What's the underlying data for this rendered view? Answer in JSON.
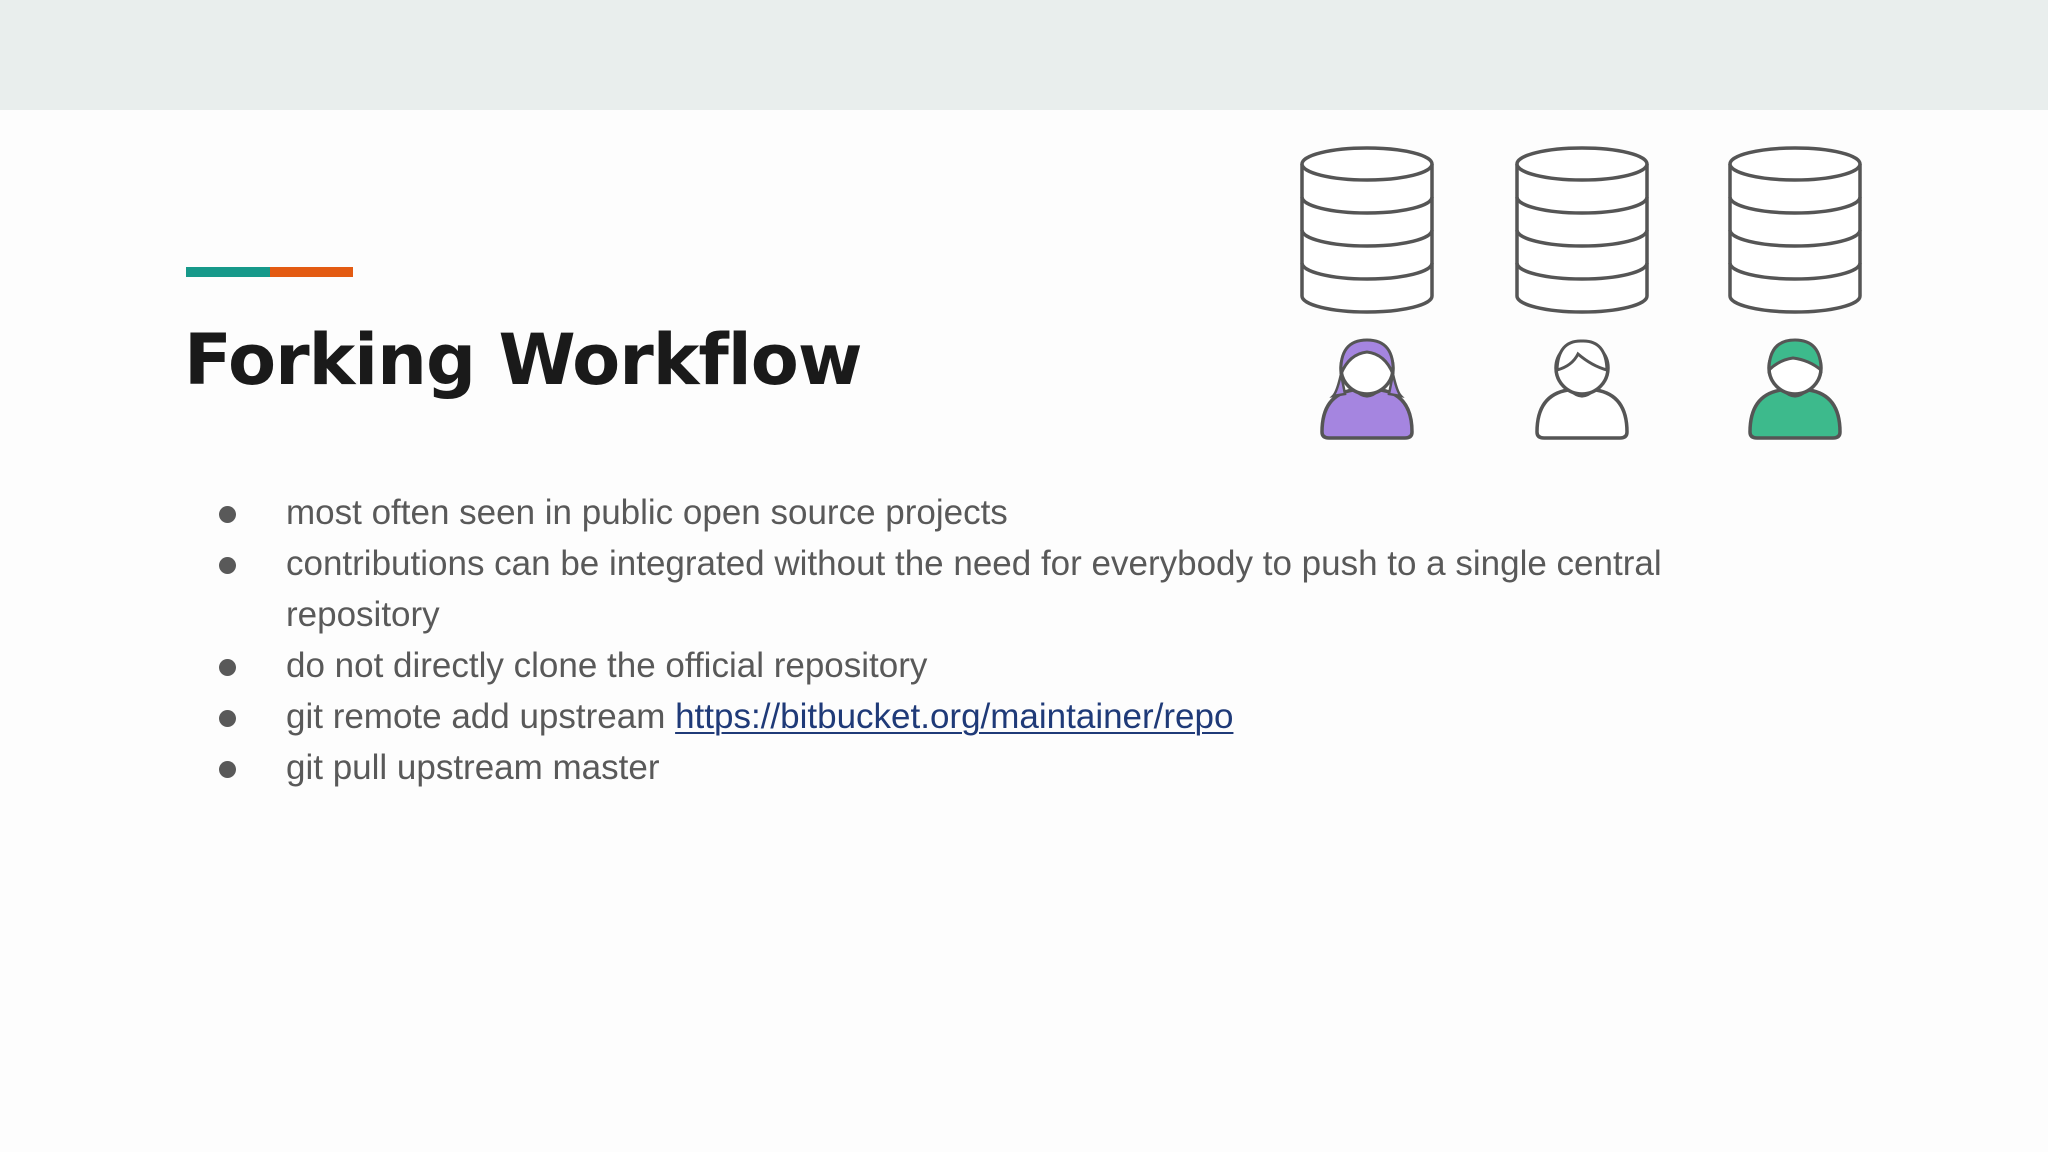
{
  "slide": {
    "title": "Forking Workflow",
    "accent_colors": [
      "#17998a",
      "#e35b12"
    ],
    "bullets": [
      {
        "text": "most often seen in public open source projects"
      },
      {
        "text": "contributions can be integrated without the need for everybody to push to a single central repository"
      },
      {
        "text": "do not directly clone the official repository"
      },
      {
        "text": "git remote add upstream ",
        "link": "https://bitbucket.org/maintainer/repo"
      },
      {
        "text": "git pull upstream master"
      }
    ]
  },
  "figure": {
    "repositories": [
      {
        "icon": "database-icon"
      },
      {
        "icon": "database-icon"
      },
      {
        "icon": "database-icon"
      }
    ],
    "developers": [
      {
        "icon": "person-icon",
        "color": "#a585e0"
      },
      {
        "icon": "person-icon",
        "color": "#ffffff"
      },
      {
        "icon": "person-icon",
        "color": "#3dba8c"
      }
    ]
  }
}
